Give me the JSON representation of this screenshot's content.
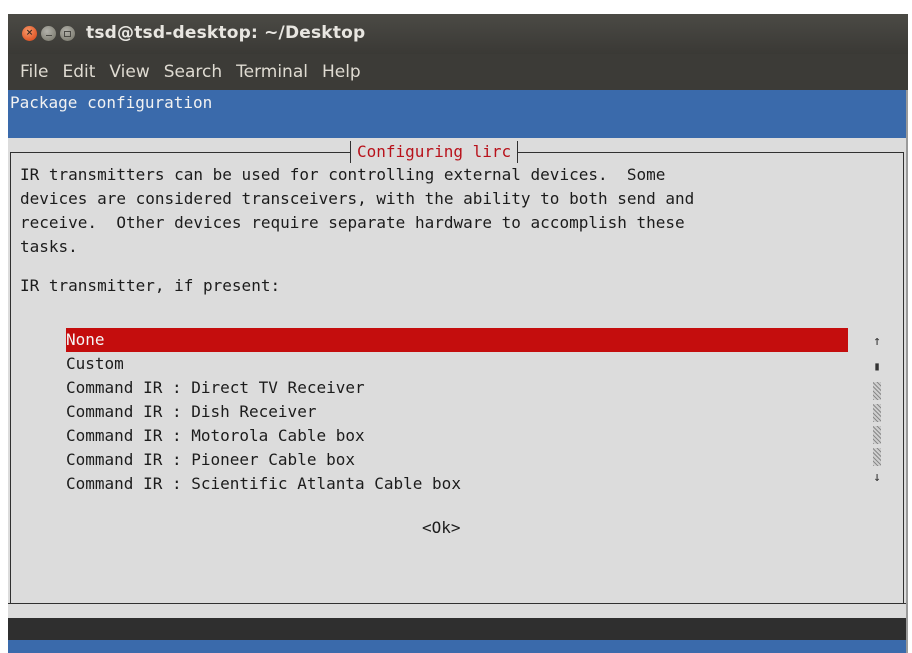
{
  "window": {
    "title": "tsd@tsd-desktop: ~/Desktop",
    "buttons": {
      "close": "×",
      "minimize": "",
      "maximize": ""
    }
  },
  "menubar": {
    "items": [
      "File",
      "Edit",
      "View",
      "Search",
      "Terminal",
      "Help"
    ]
  },
  "terminal": {
    "header": "Package configuration",
    "dialog": {
      "title": "Configuring lirc",
      "description": [
        "IR transmitters can be used for controlling external devices.  Some",
        "devices are considered transceivers, with the ability to both send and",
        "receive.  Other devices require separate hardware to accomplish these",
        "tasks."
      ],
      "prompt": "IR transmitter, if present:",
      "options": [
        "None",
        "Custom",
        "Command IR : Direct TV Receiver",
        "Command IR : Dish Receiver",
        "Command IR : Motorola Cable box",
        "Command IR : Pioneer Cable box",
        "Command IR : Scientific Atlanta Cable box"
      ],
      "selected_option": "None",
      "scrollbar": {
        "up_arrow": "↑",
        "thumb": "▮",
        "down_arrow": "↓"
      },
      "ok_button": "<Ok>"
    }
  },
  "colors": {
    "header_blue": "#3a6aab",
    "dialog_bg": "#dcdcdc",
    "dialog_title": "#b8121b",
    "selection": "#c40d0d",
    "chrome": "#3c3b37"
  }
}
